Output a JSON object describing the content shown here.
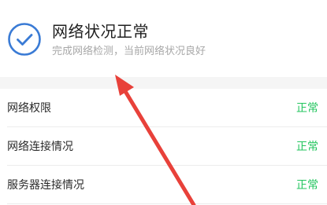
{
  "status": {
    "title": "网络状况正常",
    "subtitle": "完成网络检测，当前网络状况良好",
    "icon": "check-circle-icon",
    "accent_color": "#3a7bd5"
  },
  "checks": [
    {
      "label": "网络权限",
      "status": "正常"
    },
    {
      "label": "网络连接情况",
      "status": "正常"
    },
    {
      "label": "服务器连接情况",
      "status": "正常"
    }
  ],
  "colors": {
    "ok_status": "#22c55e",
    "annotation_arrow": "#e8413a"
  }
}
